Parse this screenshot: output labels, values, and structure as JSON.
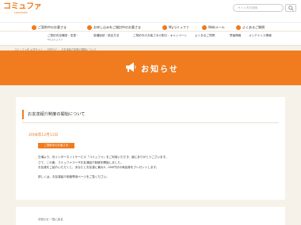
{
  "header": {
    "logo_main": "コミュファ",
    "logo_sub": "commufa",
    "search_placeholder": "サイト内を検索"
  },
  "nav_primary": [
    {
      "label": "ご契約中のお客さま"
    },
    {
      "label": "お申し込みをご検討中のお客さま"
    },
    {
      "label": "Myコミュファ"
    },
    {
      "label": "Webメール"
    },
    {
      "label": "よくあるご質問"
    }
  ],
  "nav_secondary": [
    {
      "label": "ご契約内容確認・変更・",
      "sub": "Myコミュファ"
    },
    {
      "label": "各種接続・設定方法"
    },
    {
      "label": "ご契約中のお客さまの割引・キャンペーン"
    },
    {
      "label": "よくあるご質問"
    },
    {
      "label": "障害情報"
    },
    {
      "label": "メンテナンス情報"
    }
  ],
  "breadcrumb": [
    "コミュファ光 公式サイト",
    "お知らせ",
    "お友達紹介制度の開始について"
  ],
  "hero": {
    "title": "お知らせ"
  },
  "article": {
    "title": "お友達紹介制度の開始について",
    "date": "2008年12月11日",
    "badge": "ご契約中のお客さま",
    "paragraphs": [
      "日頃より、光インターネットサービス「コミュファ」をご利用いただき、誠にありがとうございます。",
      "さて、この度、コミュファユーザお友達紹介制度を開始しました。",
      "お友達をご紹介いただくと、あなたとお友達に最大5，000円分の商品券をプレゼントします。",
      "詳しくは、お友達紹介制度専用ページをご覧ください。"
    ]
  },
  "footer_link": "お知らせ 一覧に戻る"
}
